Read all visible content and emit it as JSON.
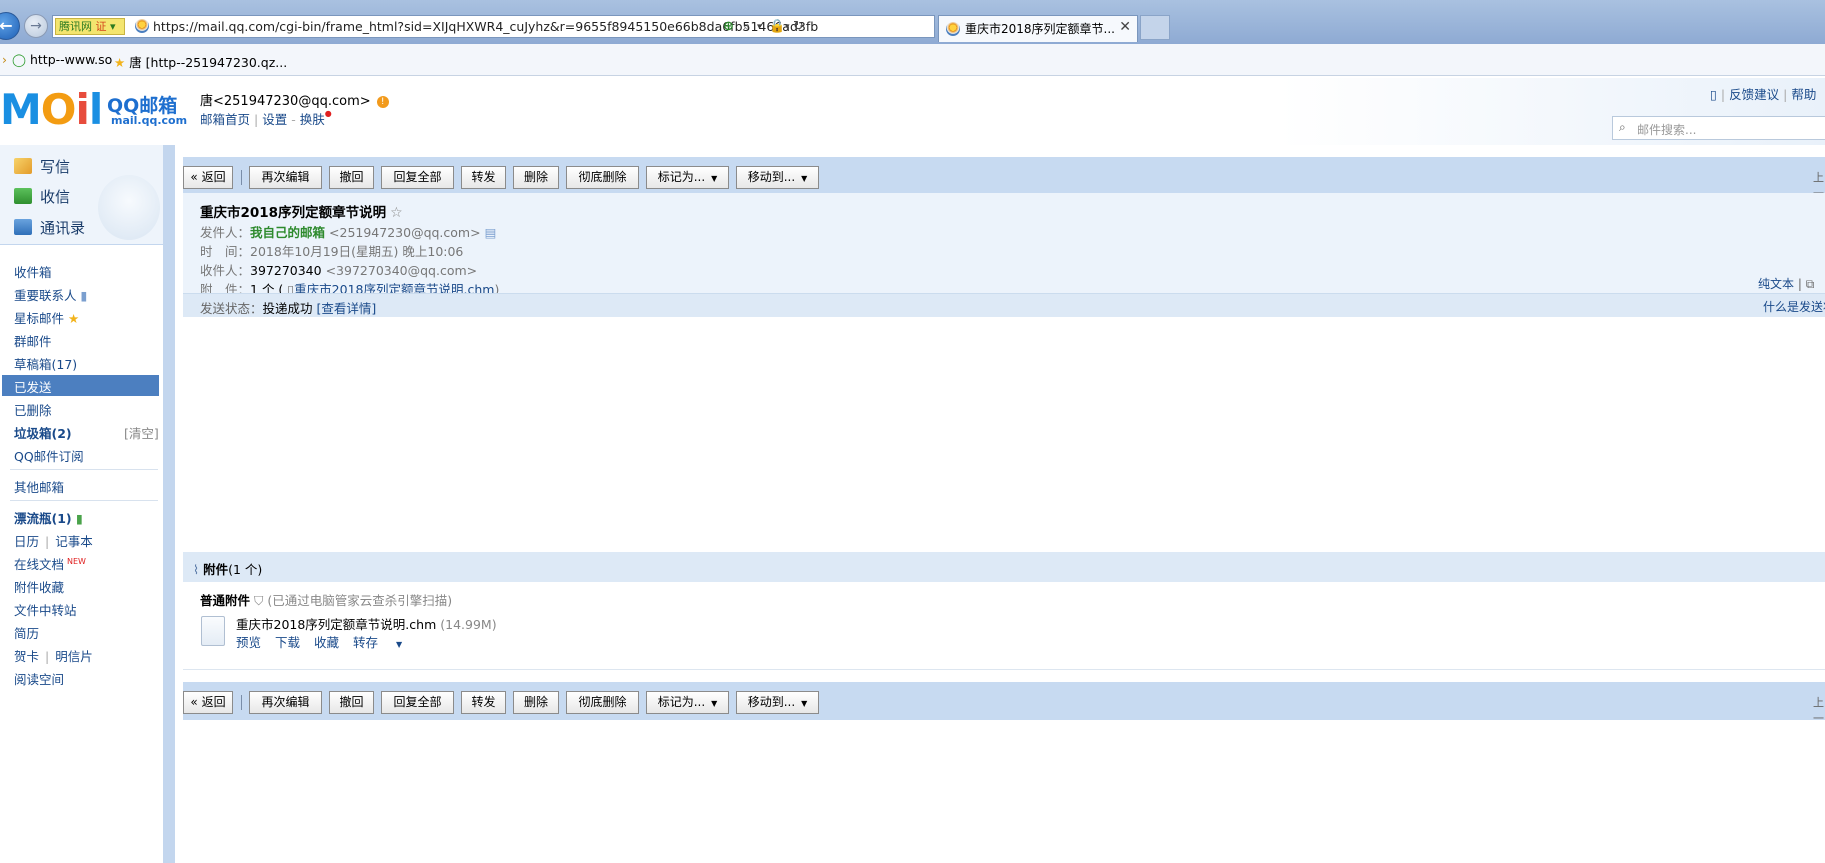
{
  "browser": {
    "url": "https://mail.qq.com/cgi-bin/frame_html?sid=XIJqHXWR4_cuJyhz&r=9655f8945150e66b8da6fb51466ad3fb",
    "partner_tag": "腾讯网",
    "partner_badge": "证",
    "tab_title": "重庆市2018序列定额章节...",
    "favorites": [
      "http--www.so",
      "唐 [http--251947230.qz..."
    ]
  },
  "header": {
    "logo_mail": "MOil",
    "logo_qq": "QQ邮箱",
    "logo_url": "mail.qq.com",
    "user": "唐<251947230@qq.com>",
    "links": [
      "邮箱首页",
      "设置",
      "换肤"
    ],
    "right_links": [
      "反馈建议",
      "帮助"
    ],
    "search_placeholder": "邮件搜索..."
  },
  "sidebar": {
    "compose": "写信",
    "inbox_btn": "收信",
    "contacts": "通讯录",
    "folders": {
      "inbox": "收件箱",
      "vip": "重要联系人",
      "starred": "星标邮件",
      "group": "群邮件",
      "drafts": "草稿箱(17)",
      "sent": "已发送",
      "deleted": "已删除",
      "spam": "垃圾箱(2)",
      "spam_clear": "[清空]",
      "subscribe": "QQ邮件订阅",
      "other": "其他邮箱",
      "bottle": "漂流瓶(1)",
      "calendar": "日历",
      "notes": "记事本",
      "docs": "在线文档",
      "docs_badge": "NEW",
      "att_fav": "附件收藏",
      "transfer": "文件中转站",
      "resume": "简历",
      "card": "贺卡",
      "postcard": "明信片",
      "reading": "阅读空间"
    }
  },
  "toolbar": {
    "back": "« 返回",
    "reedit": "再次编辑",
    "recall": "撤回",
    "reply_all": "回复全部",
    "forward": "转发",
    "delete": "删除",
    "delete_perm": "彻底删除",
    "mark_as": "标记为...",
    "move_to": "移动到...",
    "prev": "上一"
  },
  "mail": {
    "subject": "重庆市2018序列定额章节说明",
    "from_label": "发件人：",
    "from_name": "我自己的邮箱",
    "from_addr": "<251947230@qq.com>",
    "time_label": "时　间：",
    "time": "2018年10月19日(星期五) 晚上10:06",
    "to_label": "收件人：",
    "to_name": "397270340",
    "to_addr": "<397270340@qq.com>",
    "att_label": "附　件：",
    "att_count": "1 个 (",
    "att_file": "重庆市2018序列定额章节说明.chm",
    "att_close": ")",
    "plain_text": "纯文本",
    "status_label": "发送状态：",
    "status": "投递成功",
    "status_detail": "[查看详情]",
    "what_status": "什么是发送状"
  },
  "attachment": {
    "title": "附件",
    "count": "(1 个)",
    "type": "普通附件",
    "scan": "(已通过电脑管家云查杀引擎扫描)",
    "filename": "重庆市2018序列定额章节说明.chm",
    "size": "(14.99M)",
    "actions": [
      "预览",
      "下载",
      "收藏",
      "转存"
    ]
  }
}
